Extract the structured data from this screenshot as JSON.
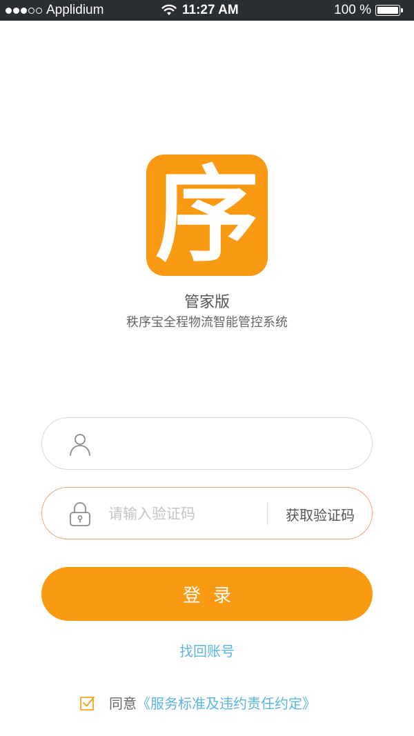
{
  "status_bar": {
    "carrier": "Applidium",
    "time": "11:27 AM",
    "battery_text": "100 %",
    "battery_level": 1.0,
    "signal_icon": "signal-dots-icon",
    "wifi_icon": "wifi-icon",
    "battery_icon": "battery-icon"
  },
  "logo": {
    "char": "序",
    "color": "#f99a12"
  },
  "app": {
    "edition": "管家版",
    "subtitle": "秩序宝全程物流智能管控系统"
  },
  "form": {
    "phone_value": "",
    "phone_icon": "user-icon",
    "code_placeholder": "请输入验证码",
    "code_value": "",
    "code_icon": "lock-icon",
    "get_code_label": "获取验证码",
    "login_label": "登录"
  },
  "links": {
    "recover": "找回账号"
  },
  "agreement": {
    "checked": true,
    "checkbox_icon": "checkbox-checked-icon",
    "prefix": "同意",
    "terms": "《服务标准及违约责任约定》"
  },
  "colors": {
    "accent": "#f99a12",
    "link": "#5ab4e0",
    "status_bar": "#2b2e33",
    "code_border": "#f3a277"
  }
}
